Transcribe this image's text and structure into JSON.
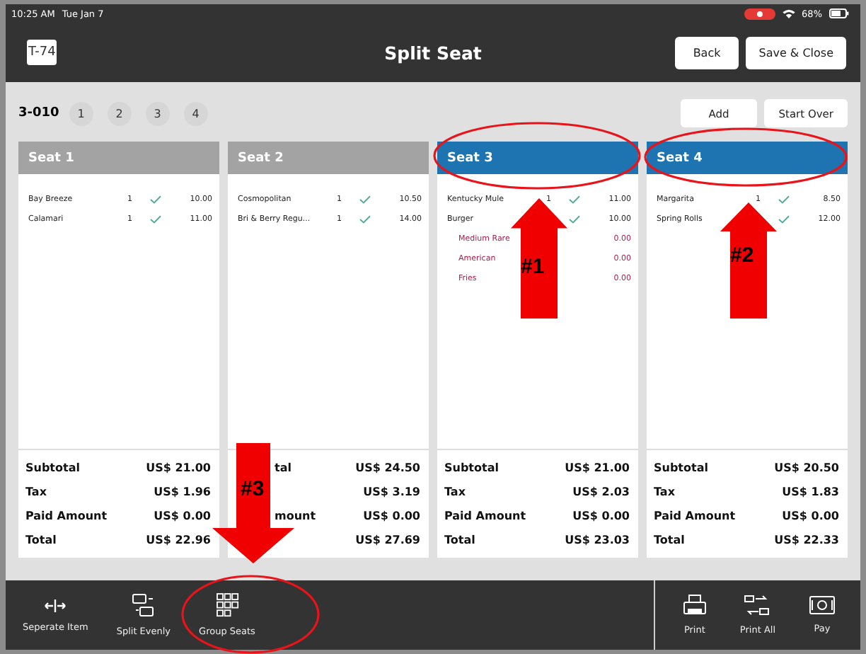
{
  "status_bar": {
    "time": "10:25 AM",
    "date": "Tue Jan 7",
    "battery": "68%"
  },
  "header": {
    "table_badge": "T-74",
    "title": "Split Seat",
    "buttons": [
      "Back",
      "Save & Close"
    ]
  },
  "check": {
    "number": "3-010",
    "seat_numbers": [
      "1",
      "2",
      "3",
      "4"
    ],
    "actions": [
      "Add",
      "Start Over"
    ]
  },
  "seats": [
    {
      "name": "Seat 1",
      "selected": false,
      "items": [
        {
          "kind": "item",
          "name": "Bay Breeze",
          "qty": "1",
          "price": "10.00"
        },
        {
          "kind": "item",
          "name": "Calamari",
          "qty": "1",
          "price": "11.00"
        }
      ],
      "summary": [
        {
          "label": "Subtotal",
          "value": "US$ 21.00"
        },
        {
          "label": "Tax",
          "value": "US$ 1.96"
        },
        {
          "label": "Paid Amount",
          "value": "US$ 0.00"
        },
        {
          "label": "Total",
          "value": "US$ 22.96"
        }
      ]
    },
    {
      "name": "Seat 2",
      "selected": false,
      "items": [
        {
          "kind": "item",
          "name": "Cosmopolitan",
          "qty": "1",
          "price": "10.50"
        },
        {
          "kind": "item",
          "name": "Bri & Berry Regu...",
          "qty": "1",
          "price": "14.00"
        }
      ],
      "summary": [
        {
          "label": "tal",
          "value": "US$ 24.50"
        },
        {
          "value": "US$ 3.19"
        },
        {
          "label": "mount",
          "value": "US$ 0.00"
        },
        {
          "value": "US$ 27.69"
        }
      ]
    },
    {
      "name": "Seat 3",
      "selected": true,
      "items": [
        {
          "kind": "item",
          "name": "Kentucky Mule",
          "qty": "1",
          "price": "11.00"
        },
        {
          "kind": "item",
          "name": "Burger",
          "price": "10.00"
        },
        {
          "kind": "modifier",
          "name": "Medium Rare",
          "price": "0.00"
        },
        {
          "kind": "modifier",
          "name": "American",
          "price": "0.00"
        },
        {
          "kind": "modifier",
          "name": "Fries",
          "price": "0.00"
        }
      ],
      "summary": [
        {
          "label": "Subtotal",
          "value": "US$ 21.00"
        },
        {
          "label": "Tax",
          "value": "US$ 2.03"
        },
        {
          "label": "Paid Amount",
          "value": "US$ 0.00"
        },
        {
          "label": "Total",
          "value": "US$ 23.03"
        }
      ]
    },
    {
      "name": "Seat 4",
      "selected": true,
      "items": [
        {
          "kind": "item",
          "name": "Margarita",
          "qty": "1",
          "price": "8.50"
        },
        {
          "kind": "item",
          "name": "Spring Rolls",
          "price": "12.00"
        }
      ],
      "summary": [
        {
          "label": "Subtotal",
          "value": "US$ 20.50"
        },
        {
          "label": "Tax",
          "value": "US$ 1.83"
        },
        {
          "label": "Paid Amount",
          "value": "US$ 0.00"
        },
        {
          "label": "Total",
          "value": "US$ 22.33"
        }
      ]
    }
  ],
  "toolbar": {
    "left": [
      {
        "kind": "separate",
        "label": "Seperate Item"
      },
      {
        "kind": "split",
        "label": "Split Evenly"
      },
      {
        "kind": "group",
        "label": "Group Seats"
      }
    ],
    "right": [
      {
        "kind": "print",
        "label": "Print"
      },
      {
        "kind": "print_all",
        "label": "Print All"
      },
      {
        "kind": "pay",
        "label": "Pay"
      }
    ]
  },
  "annotations": [
    {
      "kind": "ellipse"
    },
    {
      "kind": "ellipse"
    },
    {
      "kind": "arrow_up",
      "label": "#1"
    },
    {
      "kind": "arrow_up",
      "label": "#2"
    },
    {
      "kind": "arrow_down",
      "label": "#3"
    },
    {
      "kind": "ellipse"
    }
  ]
}
